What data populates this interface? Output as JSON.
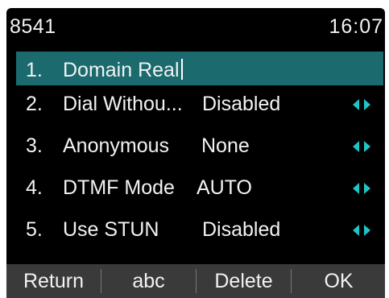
{
  "status_bar": {
    "account": "8541",
    "time": "16:07"
  },
  "menu": {
    "items": [
      {
        "num": "1.",
        "label": "Domain Real",
        "value": "",
        "selected": true,
        "cursor": true
      },
      {
        "num": "2.",
        "label": "Dial Withou...",
        "value": "Disabled",
        "selected": false
      },
      {
        "num": "3.",
        "label": "Anonymous",
        "value": "None",
        "selected": false
      },
      {
        "num": "4.",
        "label": "DTMF Mode",
        "value": "AUTO",
        "selected": false
      },
      {
        "num": "5.",
        "label": "Use STUN",
        "value": "Disabled",
        "selected": false
      }
    ]
  },
  "softkeys": {
    "return": "Return",
    "abc": "abc",
    "delete": "Delete",
    "ok": "OK"
  },
  "colors": {
    "background": "#000000",
    "highlight": "#1b6b6e",
    "arrow": "#1fc4c4",
    "softkey_bar": "#3a3a3a",
    "text": "#f2f2f2"
  },
  "icons": {
    "row_arrows": "left-right-arrows-icon"
  }
}
